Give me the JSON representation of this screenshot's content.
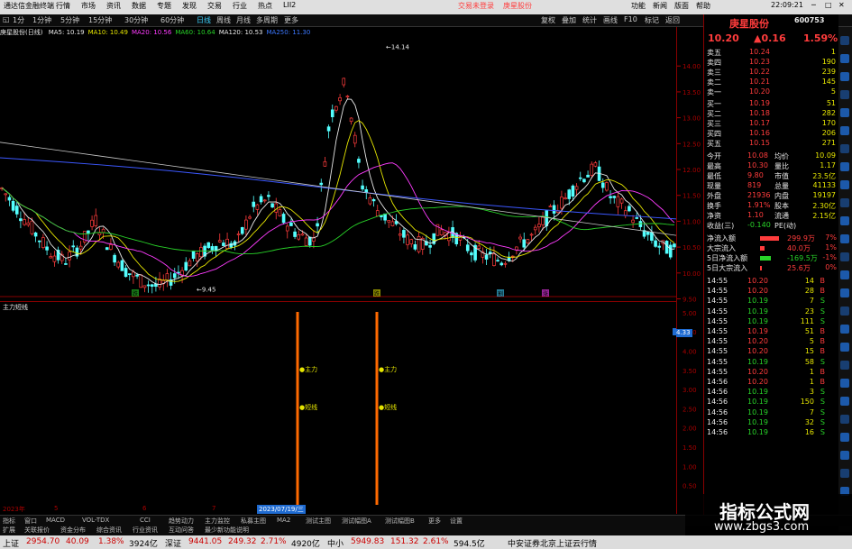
{
  "window": {
    "app_title": "通达信金融终端",
    "menu": [
      "行情",
      "市场",
      "资讯",
      "数据",
      "专题",
      "发现",
      "交易",
      "行业",
      "热点",
      "LII2"
    ],
    "center_links": [
      "交易未登录",
      "庚星股份"
    ],
    "right_menu": [
      "功能",
      "新闻",
      "版面",
      "帮助"
    ],
    "clock": "22:09:21"
  },
  "toolbar": {
    "periods": [
      "1分",
      "1分钟",
      "5分钟",
      "15分钟",
      "30分钟",
      "60分钟",
      "日线",
      "周线",
      "月线",
      "多周期",
      "更多"
    ],
    "right_tools": [
      "复权",
      "叠加",
      "统计",
      "画线",
      "F10",
      "标记",
      "返回"
    ]
  },
  "chart_header": {
    "name": "庚星股份(日线)",
    "ma": [
      {
        "label": "MA5: 10.19",
        "color": "#e8e8e8"
      },
      {
        "label": "MA10: 10.49",
        "color": "#e6e600"
      },
      {
        "label": "MA20: 10.56",
        "color": "#ff3cff"
      },
      {
        "label": "MA60: 10.64",
        "color": "#28d228"
      },
      {
        "label": "MA120: 10.53",
        "color": "#e8e8e8"
      },
      {
        "label": "MA250: 11.30",
        "color": "#3c78ff"
      }
    ]
  },
  "price_axis": [
    "14.00",
    "13.50",
    "13.00",
    "12.50",
    "12.00",
    "11.50",
    "11.00",
    "10.50",
    "10.00",
    "9.50"
  ],
  "annotations": {
    "high": "14.14",
    "low": "9.45",
    "markers": [
      "跌",
      "跌",
      "割",
      "涨"
    ]
  },
  "sub": {
    "title": "主力短线",
    "axis": [
      "5.00",
      "4.50",
      "4.00",
      "3.50",
      "3.00",
      "2.50",
      "2.00",
      "1.50",
      "1.00",
      "0.50"
    ],
    "current": "4.33",
    "label_main": "主力",
    "label_short": "短线"
  },
  "time_axis": {
    "year": "2023年",
    "marks": [
      "5",
      "6",
      "7",
      "8"
    ],
    "cursor_date": "2023/07/19/三"
  },
  "quote": {
    "name": "庚星股份",
    "code": "600753",
    "price": "10.20",
    "change": "▲0.16",
    "pct": "1.59%",
    "asks": [
      {
        "l": "卖五",
        "p": "10.24",
        "v": "1"
      },
      {
        "l": "卖四",
        "p": "10.23",
        "v": "190"
      },
      {
        "l": "卖三",
        "p": "10.22",
        "v": "239"
      },
      {
        "l": "卖二",
        "p": "10.21",
        "v": "145"
      },
      {
        "l": "卖一",
        "p": "10.20",
        "v": "5"
      }
    ],
    "bids": [
      {
        "l": "买一",
        "p": "10.19",
        "v": "51"
      },
      {
        "l": "买二",
        "p": "10.18",
        "v": "282"
      },
      {
        "l": "买三",
        "p": "10.17",
        "v": "170"
      },
      {
        "l": "买四",
        "p": "10.16",
        "v": "206"
      },
      {
        "l": "买五",
        "p": "10.15",
        "v": "271"
      }
    ],
    "stats": [
      {
        "a": "今开",
        "b": "10.08",
        "c": "均价",
        "d": "10.09"
      },
      {
        "a": "最高",
        "b": "10.30",
        "c": "量比",
        "d": "1.17"
      },
      {
        "a": "最低",
        "b": "9.80",
        "c": "市值",
        "d": "23.5亿"
      },
      {
        "a": "现量",
        "b": "819",
        "c": "总量",
        "d": "41133"
      },
      {
        "a": "外盘",
        "b": "21936",
        "c": "内盘",
        "d": "19197"
      },
      {
        "a": "换手",
        "b": "1.91%",
        "c": "股本",
        "d": "2.30亿"
      },
      {
        "a": "净资",
        "b": "1.10",
        "c": "流通",
        "d": "2.15亿"
      },
      {
        "a": "收益(三)",
        "b": "-0.140",
        "c": "PE(动)",
        "d": ""
      }
    ],
    "flows": [
      {
        "l": "净流入额",
        "v": "299.9万",
        "p": "7%",
        "bar": 0.7,
        "col": "#ff3c3c"
      },
      {
        "l": "大宗流入",
        "v": "40.0万",
        "p": "1%",
        "bar": 0.15,
        "col": "#ff3c3c"
      },
      {
        "l": "5日净流入额",
        "v": "-169.5万",
        "p": "-1%",
        "bar": 0.4,
        "col": "#28d228"
      },
      {
        "l": "5日大宗流入",
        "v": "25.6万",
        "p": "0%",
        "bar": 0.05,
        "col": "#ff3c3c"
      }
    ],
    "ticks": [
      {
        "t": "14:55",
        "p": "10.20",
        "v": "14",
        "d": "B"
      },
      {
        "t": "14:55",
        "p": "10.20",
        "v": "28",
        "d": "B"
      },
      {
        "t": "14:55",
        "p": "10.19",
        "v": "7",
        "d": "S"
      },
      {
        "t": "14:55",
        "p": "10.19",
        "v": "23",
        "d": "S"
      },
      {
        "t": "14:55",
        "p": "10.19",
        "v": "111",
        "d": "S"
      },
      {
        "t": "14:55",
        "p": "10.19",
        "v": "51",
        "d": "B"
      },
      {
        "t": "14:55",
        "p": "10.20",
        "v": "5",
        "d": "B"
      },
      {
        "t": "14:55",
        "p": "10.20",
        "v": "15",
        "d": "B"
      },
      {
        "t": "14:55",
        "p": "10.19",
        "v": "58",
        "d": "S"
      },
      {
        "t": "14:55",
        "p": "10.20",
        "v": "1",
        "d": "B"
      },
      {
        "t": "14:56",
        "p": "10.20",
        "v": "1",
        "d": "B"
      },
      {
        "t": "14:56",
        "p": "10.19",
        "v": "3",
        "d": "S"
      },
      {
        "t": "14:56",
        "p": "10.19",
        "v": "150",
        "d": "S"
      },
      {
        "t": "14:56",
        "p": "10.19",
        "v": "7",
        "d": "S"
      },
      {
        "t": "14:56",
        "p": "10.19",
        "v": "32",
        "d": "S"
      },
      {
        "t": "14:56",
        "p": "10.19",
        "v": "16",
        "d": "S"
      }
    ]
  },
  "bottom_tabs": [
    "指标",
    "窗口",
    "MACD",
    "VOL-TDX",
    "CCI",
    "趋势动力",
    "主力监控",
    "私募主图",
    "MA2",
    "测试主图",
    "测试幅图A",
    "测试幅图B",
    "更多",
    "设置"
  ],
  "bottom_tabs2": [
    "扩展",
    "关联报价",
    "资金分布",
    "综合资讯",
    "行业资讯",
    "互动问答",
    "最少新功能说明"
  ],
  "status": {
    "items": [
      {
        "label": "上证",
        "val": "2954.70",
        "chg": "40.09",
        "pct": "1.38%",
        "amt": "3924亿"
      },
      {
        "label": "深证",
        "val": "9441.05",
        "chg": "249.32",
        "pct": "2.71%",
        "amt": "4920亿"
      },
      {
        "label": "中小",
        "val": "5949.83",
        "chg": "151.32",
        "pct": "2.61%",
        "amt": "594.5亿"
      }
    ],
    "right": "中安证券北京上证云行情"
  },
  "watermark": {
    "text": "指标公式网",
    "url": "www.zbgs3.com"
  }
}
